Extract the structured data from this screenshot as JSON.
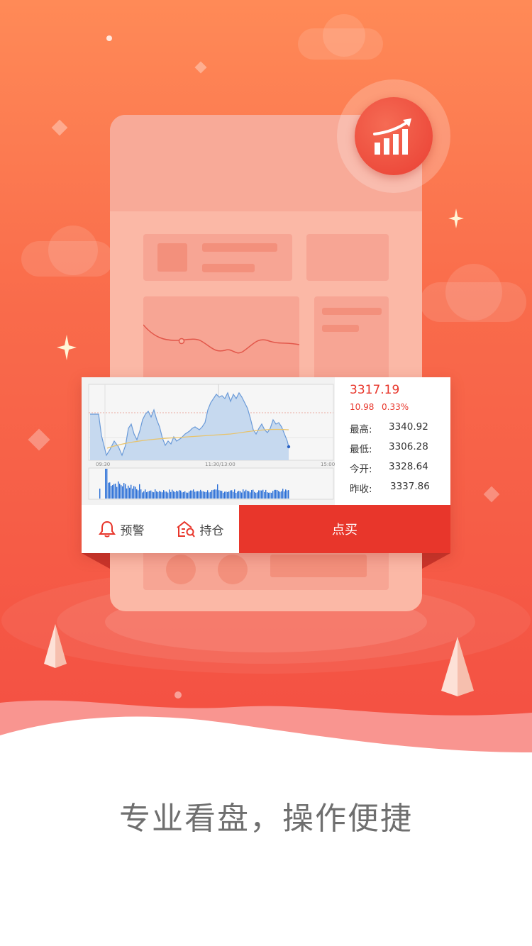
{
  "quote": {
    "price": "3317.19",
    "change": "10.98",
    "change_pct": "0.33%",
    "rows": [
      {
        "label": "最高:",
        "value": "3340.92"
      },
      {
        "label": "最低:",
        "value": "3306.28"
      },
      {
        "label": "今开:",
        "value": "3328.64"
      },
      {
        "label": "昨收:",
        "value": "3337.86"
      }
    ]
  },
  "chart_labels": {
    "start": "09:30",
    "mid": "11:30/13:00",
    "end": "15:00"
  },
  "actions": {
    "alert_label": "预警",
    "position_label": "持仓",
    "buy_label": "点买"
  },
  "slogan": "专业看盘，操作便捷",
  "icons": {
    "badge": "rising-chart-icon",
    "alert": "bell-icon",
    "position": "position-search-icon"
  },
  "colors": {
    "accent": "#e8362b",
    "bg_top": "#ff8a57",
    "bg_bottom": "#f34e42",
    "slogan": "#6f6f6f"
  }
}
